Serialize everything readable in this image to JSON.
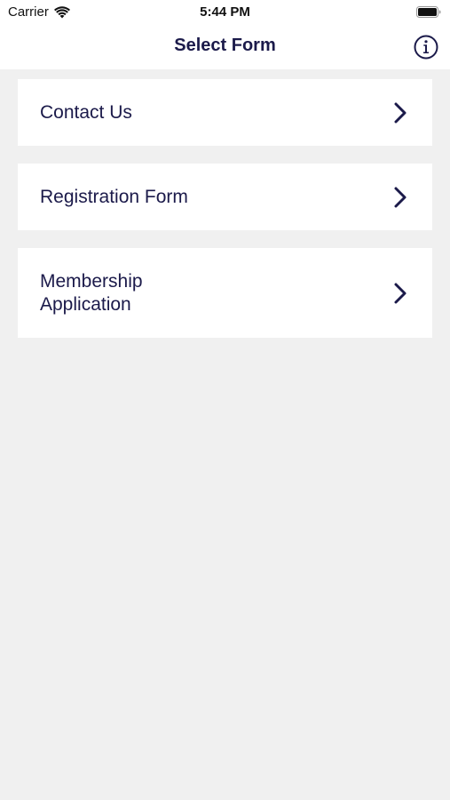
{
  "status_bar": {
    "carrier": "Carrier",
    "time": "5:44 PM",
    "wifi_icon": "wifi-icon",
    "battery_icon": "battery-icon"
  },
  "nav": {
    "title": "Select Form",
    "info_icon": "info-icon"
  },
  "forms": [
    {
      "label": "Contact Us",
      "icon": "chevron-right-icon"
    },
    {
      "label": "Registration Form",
      "icon": "chevron-right-icon"
    },
    {
      "label": "Membership Application",
      "icon": "chevron-right-icon"
    }
  ],
  "colors": {
    "text": "#1b1a4a",
    "background": "#f0f0f0",
    "card": "#ffffff"
  }
}
